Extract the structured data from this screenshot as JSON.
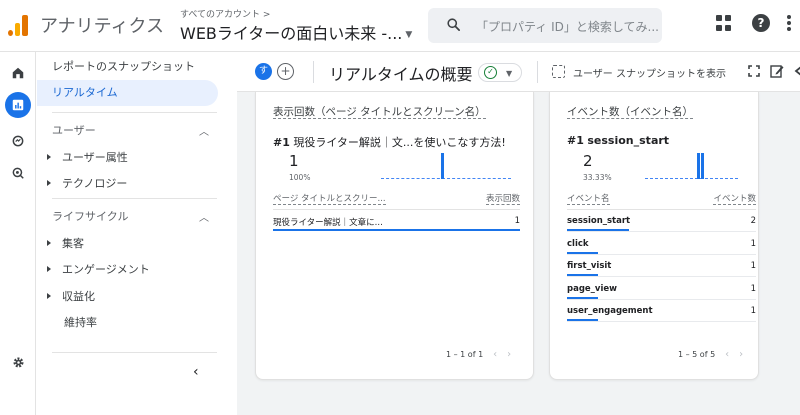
{
  "topbar": {
    "app_title": "アナリティクス",
    "account_crumb": "すべてのアカウント >",
    "property_name": "WEBライターの面白い未来 -...",
    "search_placeholder": "「プロパティ ID」と検索してみ..."
  },
  "nav": {
    "snapshot_label": "レポートのスナップショット",
    "realtime_label": "リアルタイム",
    "user_section": "ユーザー",
    "user_items": [
      "ユーザー属性",
      "テクノロジー"
    ],
    "lifecycle_section": "ライフサイクル",
    "lifecycle_items": [
      "集客",
      "エンゲージメント",
      "収益化"
    ],
    "retention_label": "維持率"
  },
  "subbar": {
    "avatar_letter": "す",
    "add_label": "+",
    "page_title": "リアルタイムの概要",
    "snapshot_button": "ユーザー スナップショットを表示"
  },
  "cards": [
    {
      "title": "表示回数（ページ タイトルとスクリーン名）",
      "top_rank": "#1",
      "top_label": "現役ライター解説｜文...を使いこなす方法!",
      "top_value": "1",
      "top_pct": "100%",
      "col1": "ページ タイトルとスクリー...",
      "col2": "表示回数",
      "rows": [
        {
          "name": "現役ライター解説｜文章に...",
          "value": "1",
          "share": 1.0
        }
      ],
      "pager": "1 – 1 of 1"
    },
    {
      "title": "イベント数（イベント名）",
      "top_rank": "#1",
      "top_label": "session_start",
      "top_value": "2",
      "top_pct": "33.33%",
      "col1": "イベント名",
      "col2": "イベント数",
      "rows": [
        {
          "name": "session_start",
          "value": "2",
          "share": 1.0
        },
        {
          "name": "click",
          "value": "1",
          "share": 0.5
        },
        {
          "name": "first_visit",
          "value": "1",
          "share": 0.5
        },
        {
          "name": "page_view",
          "value": "1",
          "share": 0.5
        },
        {
          "name": "user_engagement",
          "value": "1",
          "share": 0.5
        }
      ],
      "pager": "1 – 5 of 5"
    }
  ],
  "colors": {
    "accent": "#1a73e8",
    "active_nav_bg": "#e8f0fe",
    "logo_orange": "#e37400",
    "logo_yellow": "#f9ab00"
  },
  "icons": [
    "analytics-logo-icon",
    "search-icon",
    "apps-grid-icon",
    "help-icon",
    "more-vert-icon",
    "home-icon",
    "reports-icon",
    "explore-icon",
    "advertising-icon",
    "settings-icon",
    "collapse-chevron-icon",
    "snapshot-icon",
    "fullscreen-icon",
    "edit-icon",
    "share-icon"
  ]
}
